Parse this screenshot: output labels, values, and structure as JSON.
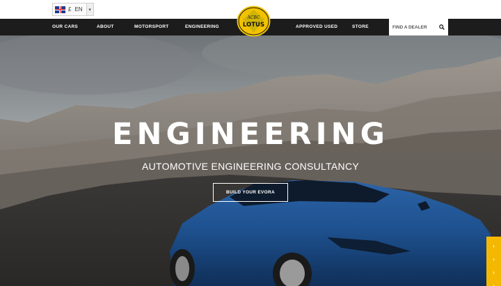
{
  "locale": {
    "currency": "£",
    "language": "EN",
    "flag": "uk-flag-icon"
  },
  "logo": {
    "text": "LOTUS",
    "monogram": "ACBC",
    "colors": {
      "ring": "#f2c200",
      "center": "#0b6b3a"
    }
  },
  "nav": {
    "items": [
      {
        "label": "OUR CARS"
      },
      {
        "label": "ABOUT"
      },
      {
        "label": "MOTORSPORT"
      },
      {
        "label": "ENGINEERING"
      },
      {
        "label": "APPROVED USED"
      },
      {
        "label": "STORE"
      }
    ],
    "search_placeholder": "FIND A DEALER"
  },
  "hero": {
    "title": "ENGINEERING",
    "subtitle": "AUTOMOTIVE ENGINEERING CONSULTANCY",
    "cta": "BUILD YOUR EVORA"
  },
  "side_tab": {
    "arrows": [
      "›",
      "›",
      "›",
      "›"
    ],
    "color": "#f5b800"
  },
  "colors": {
    "nav_bg": "#1c1c1c",
    "accent": "#f5b800",
    "car": "#1d4f8c"
  }
}
